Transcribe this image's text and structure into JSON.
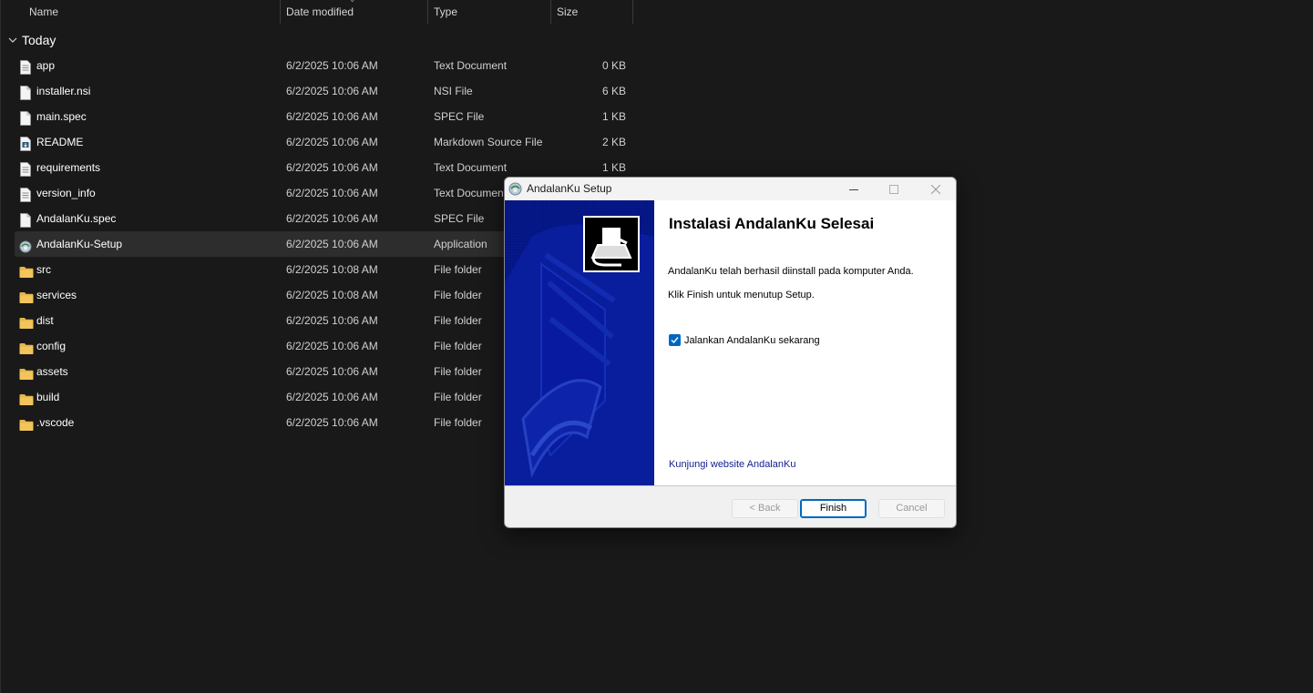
{
  "explorer": {
    "columns": {
      "name": "Name",
      "date_modified": "Date modified",
      "type": "Type",
      "size": "Size"
    },
    "group": "Today",
    "files": [
      {
        "name": "app",
        "date": "6/2/2025 10:06 AM",
        "type": "Text Document",
        "size": "0 KB",
        "icon": "text-file-icon"
      },
      {
        "name": "installer.nsi",
        "date": "6/2/2025 10:06 AM",
        "type": "NSI File",
        "size": "6 KB",
        "icon": "file-icon"
      },
      {
        "name": "main.spec",
        "date": "6/2/2025 10:06 AM",
        "type": "SPEC File",
        "size": "1 KB",
        "icon": "file-icon"
      },
      {
        "name": "README",
        "date": "6/2/2025 10:06 AM",
        "type": "Markdown Source File",
        "size": "2 KB",
        "icon": "markdown-file-icon"
      },
      {
        "name": "requirements",
        "date": "6/2/2025 10:06 AM",
        "type": "Text Document",
        "size": "1 KB",
        "icon": "text-file-icon"
      },
      {
        "name": "version_info",
        "date": "6/2/2025 10:06 AM",
        "type": "Text Documen",
        "size": "",
        "icon": "text-file-icon"
      },
      {
        "name": "AndalanKu.spec",
        "date": "6/2/2025 10:06 AM",
        "type": "SPEC File",
        "size": "",
        "icon": "file-icon"
      },
      {
        "name": "AndalanKu-Setup",
        "date": "6/2/2025 10:06 AM",
        "type": "Application",
        "size": "",
        "icon": "installer-app-icon",
        "selected": true
      },
      {
        "name": "src",
        "date": "6/2/2025 10:08 AM",
        "type": "File folder",
        "size": "",
        "icon": "folder-icon"
      },
      {
        "name": "services",
        "date": "6/2/2025 10:08 AM",
        "type": "File folder",
        "size": "",
        "icon": "folder-icon"
      },
      {
        "name": "dist",
        "date": "6/2/2025 10:06 AM",
        "type": "File folder",
        "size": "",
        "icon": "folder-icon"
      },
      {
        "name": "config",
        "date": "6/2/2025 10:06 AM",
        "type": "File folder",
        "size": "",
        "icon": "folder-icon"
      },
      {
        "name": "assets",
        "date": "6/2/2025 10:06 AM",
        "type": "File folder",
        "size": "",
        "icon": "folder-icon"
      },
      {
        "name": "build",
        "date": "6/2/2025 10:06 AM",
        "type": "File folder",
        "size": "",
        "icon": "folder-icon"
      },
      {
        "name": ".vscode",
        "date": "6/2/2025 10:06 AM",
        "type": "File folder",
        "size": "",
        "icon": "folder-icon"
      }
    ]
  },
  "dialog": {
    "title": "AndalanKu Setup",
    "heading": "Instalasi AndalanKu Selesai",
    "message_installed": "AndalanKu telah berhasil diinstall pada komputer Anda.",
    "message_finish": "Klik Finish untuk menutup Setup.",
    "checkbox_label": "Jalankan AndalanKu sekarang",
    "checkbox_checked": true,
    "link_text": "Kunjungi website AndalanKu",
    "buttons": {
      "back": "< Back",
      "finish": "Finish",
      "cancel": "Cancel"
    }
  },
  "colors": {
    "explorer_bg": "#191919",
    "selected_row": "#2d2d2d",
    "folder": "#f2c55c",
    "accent": "#0067c0",
    "side_panel": "#061888",
    "link": "#0f1f8f"
  }
}
